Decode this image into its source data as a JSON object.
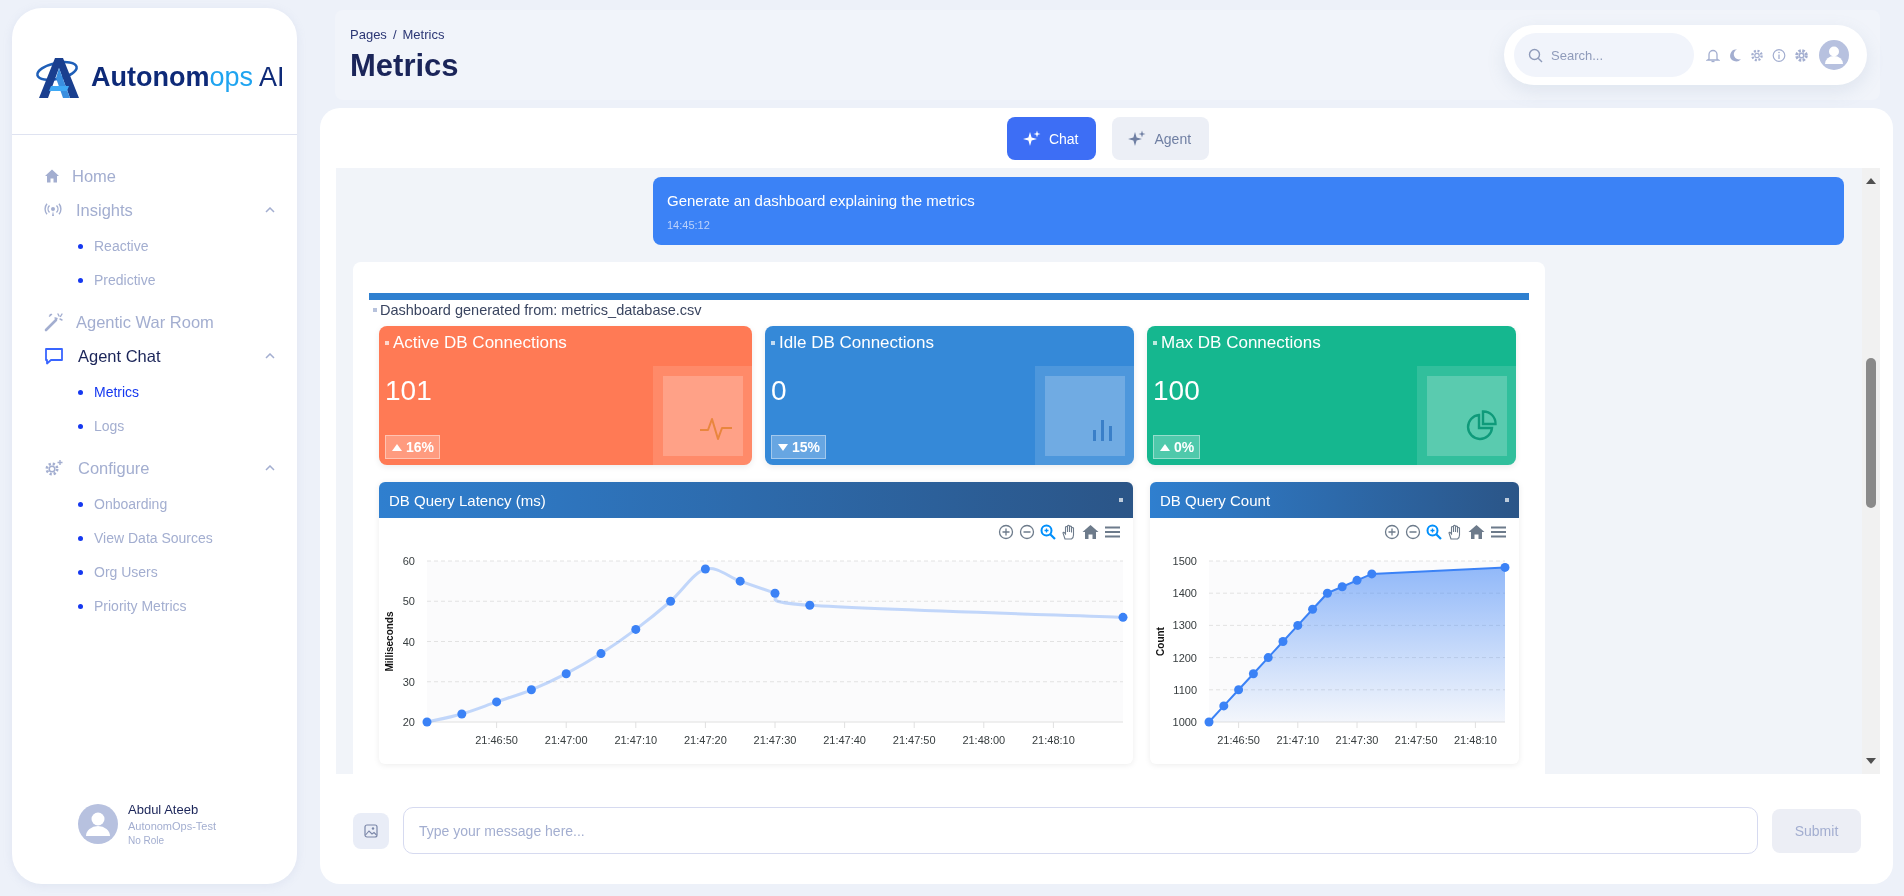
{
  "sidebar": {
    "logo": [
      {
        "text": "Autonom",
        "kind": "main"
      },
      {
        "text": "ops",
        "kind": "accent"
      },
      {
        "text": "AI",
        "kind": "tail"
      }
    ],
    "nav": [
      {
        "label": "Home",
        "selected": false
      },
      {
        "label": "Insights",
        "selected": false,
        "expanded": true,
        "children": [
          {
            "label": "Reactive",
            "selected": false
          },
          {
            "label": "Predictive",
            "selected": false
          }
        ]
      },
      {
        "label": "Agentic War Room",
        "selected": false
      },
      {
        "label": "Agent Chat",
        "selected": true,
        "expanded": true,
        "children": [
          {
            "label": "Metrics",
            "selected": true
          },
          {
            "label": "Logs",
            "selected": false
          }
        ]
      },
      {
        "label": "Configure",
        "selected": false,
        "expanded": true,
        "children": [
          {
            "label": "Onboarding",
            "selected": false
          },
          {
            "label": "View Data Sources",
            "selected": false
          },
          {
            "label": "Org Users",
            "selected": false
          },
          {
            "label": "Priority Metrics",
            "selected": false
          }
        ]
      }
    ],
    "user": {
      "name": "Abdul Ateeb",
      "org": "AutonomOps-Test",
      "role": "No Role"
    }
  },
  "header": {
    "breadcrumb": [
      "Pages",
      "Metrics"
    ],
    "separator": "/",
    "title": "Metrics",
    "search": {
      "placeholder": "Search..."
    }
  },
  "tabs": [
    {
      "label": "Chat",
      "selected": true
    },
    {
      "label": "Agent",
      "selected": false
    }
  ],
  "chat": {
    "messages": [
      {
        "kind": "user",
        "text": "Generate an dashboard explaining the metrics",
        "time": "14:45:12"
      },
      {
        "kind": "dashboard",
        "source": "Dashboard generated from: metrics_database.csv",
        "kpis": [
          {
            "title": "Active DB Connections",
            "value": "101",
            "change": "16%",
            "trend_up": true,
            "color": "#ff7a55"
          },
          {
            "title": "Idle DB Connections",
            "value": "0",
            "change": "15%",
            "trend_up": false,
            "color": "#3589d8"
          },
          {
            "title": "Max DB Connections",
            "value": "100",
            "change": "0%",
            "trend_up": true,
            "color": "#15b78f"
          }
        ],
        "charts": [
          {
            "chart_data": {
              "type": "line",
              "title": "DB Query Latency (ms)",
              "ylabel": "Milliseconds",
              "grid": true,
              "x": [
                78400,
                78405,
                78410,
                78415,
                78420,
                78425,
                78430,
                78435,
                78440,
                78445,
                78450,
                78455,
                78500
              ],
              "series": [
                {
                  "color": "#3b82f6",
                  "marker": true,
                  "values": [
                    20,
                    22,
                    25,
                    28,
                    32,
                    37,
                    43,
                    50,
                    58,
                    55,
                    52,
                    49,
                    46
                  ]
                }
              ],
              "xlim": [
                78400,
                78500
              ],
              "ylim": [
                20,
                60
              ],
              "yticks": [
                20,
                30,
                40,
                50,
                60
              ],
              "xticks": [
                {
                  "value": 78410,
                  "label": "21:46:50"
                },
                {
                  "value": 78420,
                  "label": "21:47:00"
                },
                {
                  "value": 78430,
                  "label": "21:47:10"
                },
                {
                  "value": 78440,
                  "label": "21:47:20"
                },
                {
                  "value": 78450,
                  "label": "21:47:30"
                },
                {
                  "value": 78460,
                  "label": "21:47:40"
                },
                {
                  "value": 78470,
                  "label": "21:47:50"
                },
                {
                  "value": 78480,
                  "label": "21:48:00"
                },
                {
                  "value": 78490,
                  "label": "21:48:10"
                }
              ]
            }
          },
          {
            "chart_data": {
              "type": "area",
              "title": "DB Query Count",
              "ylabel": "Count",
              "grid": true,
              "x": [
                78400,
                78405,
                78410,
                78415,
                78420,
                78425,
                78430,
                78435,
                78440,
                78445,
                78450,
                78455,
                78500
              ],
              "series": [
                {
                  "color": "#3b82f6",
                  "marker": true,
                  "values": [
                    1000,
                    1050,
                    1100,
                    1150,
                    1200,
                    1250,
                    1300,
                    1350,
                    1400,
                    1420,
                    1440,
                    1460,
                    1480
                  ]
                }
              ],
              "xlim": [
                78400,
                78500
              ],
              "ylim": [
                1000,
                1500
              ],
              "yticks": [
                1000,
                1100,
                1200,
                1300,
                1400,
                1500
              ],
              "xticks": [
                {
                  "value": 78410,
                  "label": "21:46:50"
                },
                {
                  "value": 78430,
                  "label": "21:47:10"
                },
                {
                  "value": 78450,
                  "label": "21:47:30"
                },
                {
                  "value": 78470,
                  "label": "21:47:50"
                },
                {
                  "value": 78490,
                  "label": "21:48:10"
                }
              ]
            }
          }
        ]
      }
    ]
  },
  "composer": {
    "placeholder": "Type your message here...",
    "submit": {
      "label": "Submit",
      "disabled": true
    }
  }
}
